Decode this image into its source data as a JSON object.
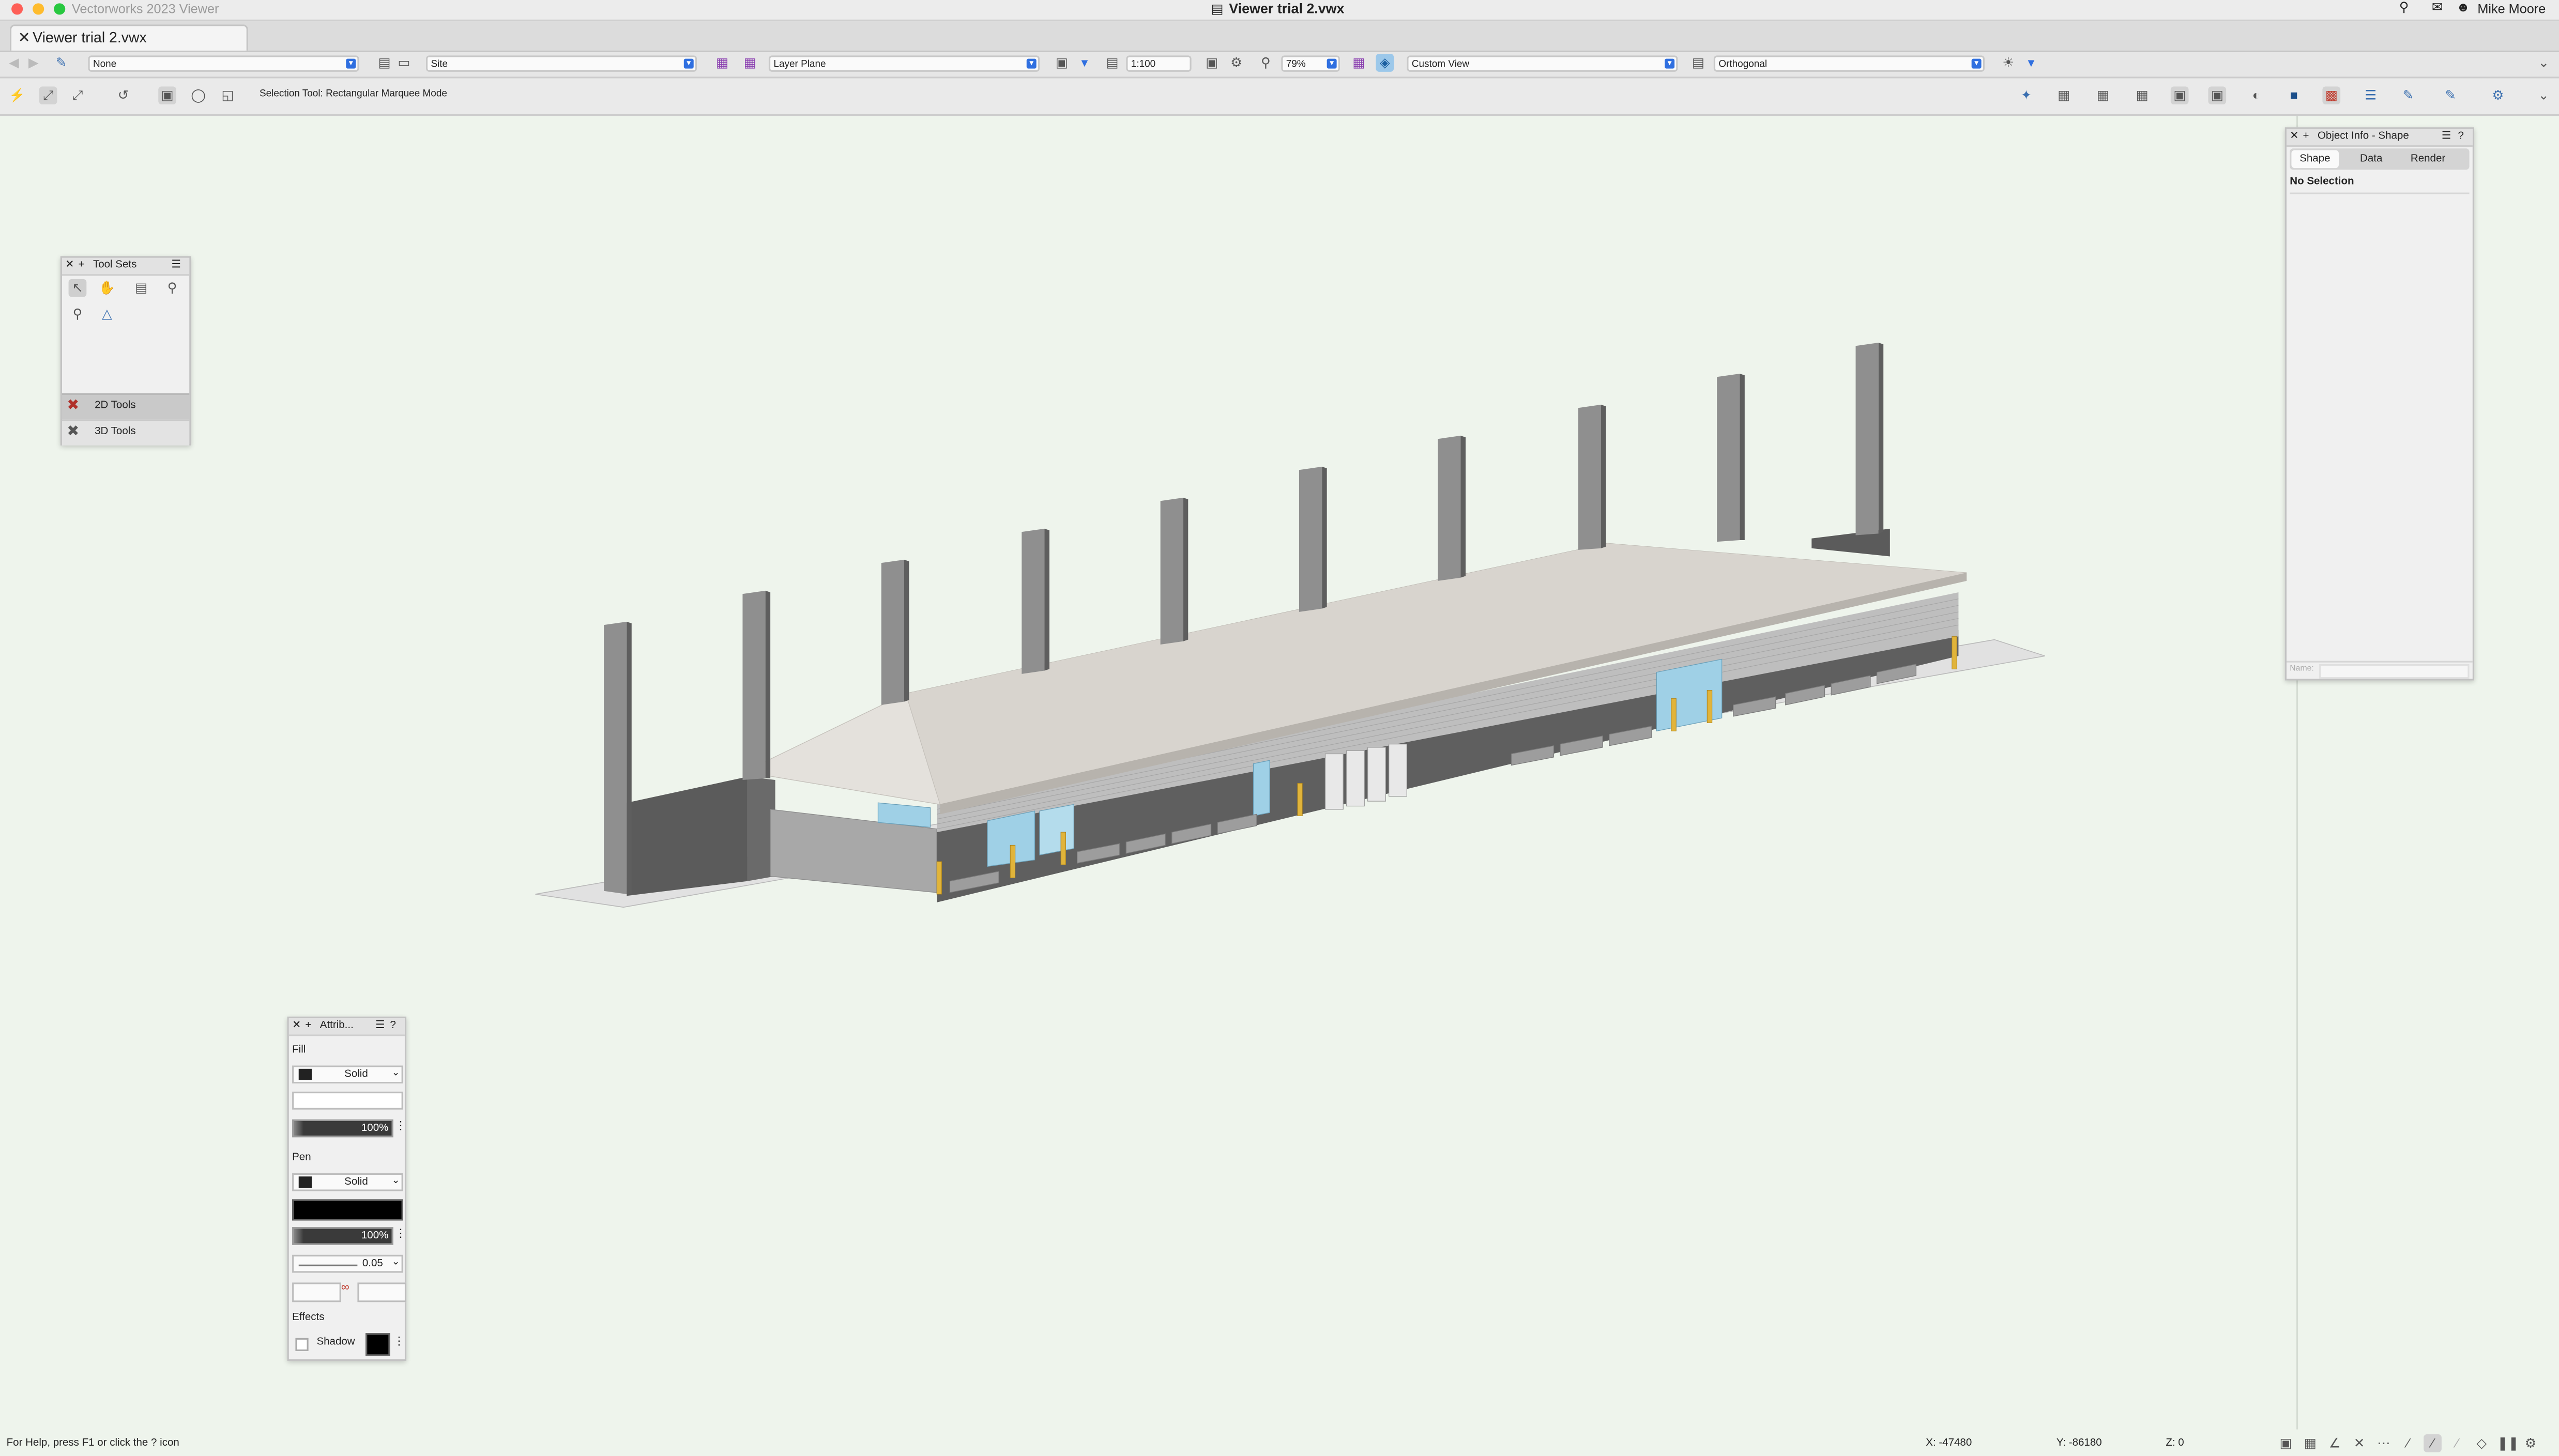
{
  "app_name": "Vectorworks 2023 Viewer",
  "window_title": "Viewer trial 2.vwx",
  "user_name": "Mike Moore",
  "tab_label": "Viewer trial 2.vwx",
  "view_bar": {
    "class_value": "None",
    "layer_value": "Site",
    "plane_value": "Layer Plane",
    "scale_value": "1:100",
    "zoom_value": "79%",
    "view_value": "Custom View",
    "projection_value": "Orthogonal"
  },
  "mode_bar": {
    "status_text": "Selection Tool: Rectangular Marquee Mode"
  },
  "tool_sets": {
    "title": "Tool Sets",
    "groups": [
      "2D Tools",
      "3D Tools"
    ]
  },
  "object_info": {
    "title": "Object Info - Shape",
    "tabs": [
      "Shape",
      "Data",
      "Render"
    ],
    "selection_text": "No Selection",
    "name_placeholder": "Name:"
  },
  "attributes": {
    "title": "Attrib...",
    "fill_label": "Fill",
    "fill_style": "Solid",
    "fill_opacity": "100%",
    "pen_label": "Pen",
    "pen_style": "Solid",
    "pen_opacity": "100%",
    "line_weight": "0.05",
    "effects_label": "Effects",
    "shadow_label": "Shadow"
  },
  "status_bar": {
    "help_text": "For Help, press F1 or click the ? icon",
    "x_coord": "X: -47480",
    "y_coord": "Y: -86180",
    "z_coord": "Z: 0"
  },
  "colors": {
    "canvas_bg": "#eef4ec",
    "accent": "#2f6fe0",
    "roof": "#d6d2cc",
    "wall_dark": "#5d5d5d",
    "column": "#8f8f8f",
    "glass": "#9fd0e6",
    "bollard": "#e1b43a"
  }
}
